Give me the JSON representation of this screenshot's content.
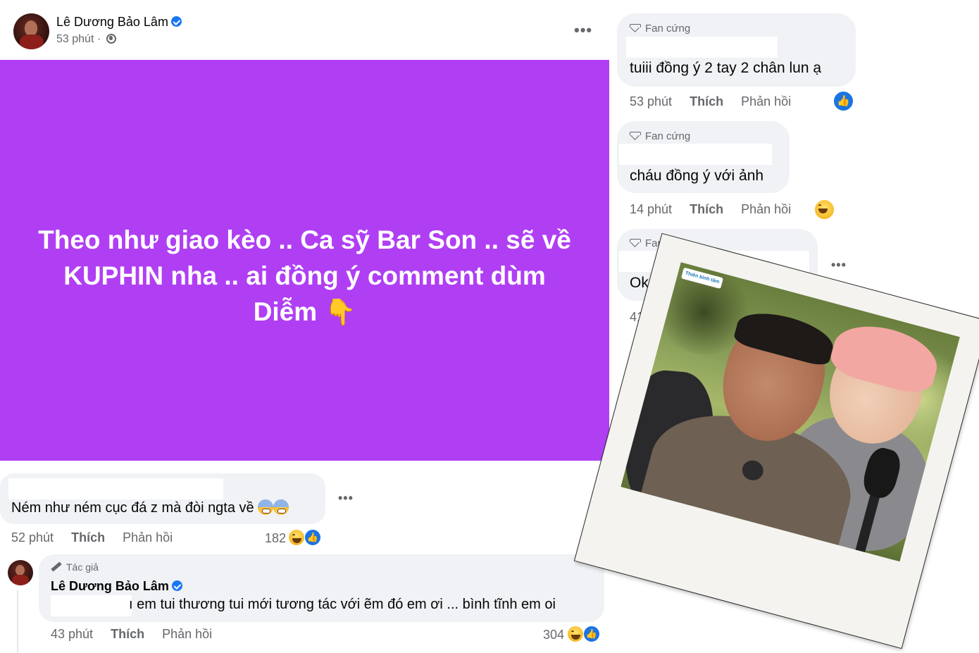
{
  "post": {
    "author": "Lê Dương Bảo Lâm",
    "time": "53 phút ·",
    "text_line1": "Theo như giao kèo .. Ca sỹ Bar Son .. sẽ về",
    "text_line2": "KUPHIN nha .. ai đồng ý comment dùm",
    "text_line3": "Diễm",
    "background_color": "#b03ff4"
  },
  "comments": [
    {
      "text": "Ném như ném cục đá z mà đòi ngta về",
      "time": "52 phút",
      "like": "Thích",
      "reply": "Phản hồi",
      "reaction_count": "182"
    }
  ],
  "author_reply": {
    "badge": "Tác giả",
    "name": "Lê Dương Bảo Lâm",
    "text": "ı em tui thương tui mới tương tác với ẽm đó em ơi ... bình tĩnh em oi",
    "time": "43 phút",
    "like": "Thích",
    "reply": "Phản hồi",
    "reaction_count": "304"
  },
  "right_comments": [
    {
      "badge": "Fan cứng",
      "text": "tuiii đồng ý 2 tay 2 chân lun ạ",
      "time": "53 phút",
      "like": "Thích",
      "reply": "Phản hồi"
    },
    {
      "badge": "Fan cứng",
      "text": "cháu đồng ý với ảnh",
      "time": "14 phút",
      "like": "Thích",
      "reply": "Phản hồi"
    },
    {
      "badge": "Fan cứng",
      "text": "Ok ko đồ",
      "time": "41 phút"
    }
  ],
  "photo_logo": "Thiên bình tâm",
  "more_icon": "•••"
}
